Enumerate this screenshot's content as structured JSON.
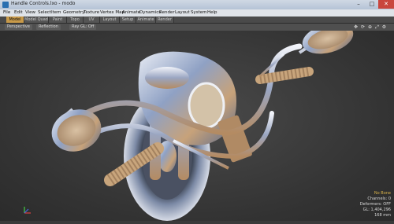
{
  "window": {
    "title": "Handle Controls.lxo - modo",
    "min": "–",
    "max": "□",
    "close": "✕"
  },
  "menu": [
    "File",
    "Edit",
    "View",
    "Select",
    "Item",
    "Geometry",
    "Texture",
    "Vertex Map",
    "Animate",
    "Dynamics",
    "Render",
    "Layout",
    "System",
    "Help"
  ],
  "tabs": [
    "Model",
    "Model Quad",
    "Paint",
    "Topo",
    "UV",
    "Layout",
    "Setup",
    "Animate",
    "Render"
  ],
  "viewport_toolbar": {
    "view": "Perspective",
    "shading": "Reflection",
    "raygl": "Ray GL: Off"
  },
  "status": {
    "bone": "No Bone",
    "channels": "Channels: 0",
    "deformers": "Deformers: OFF",
    "gl": "GL: 1,404,296",
    "size": "168 mm"
  },
  "colors": {
    "accent_tab": "#c89a4a",
    "viewport_bg": "#333333"
  },
  "icons": [
    "move-icon",
    "rotate-icon",
    "zoom-icon",
    "maximize-icon",
    "gear-icon"
  ]
}
